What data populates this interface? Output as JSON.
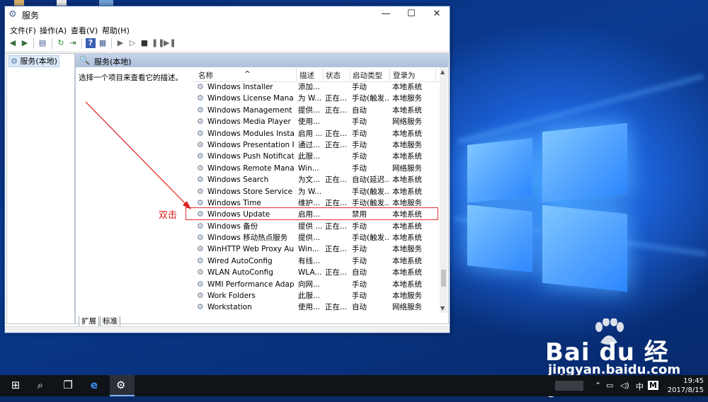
{
  "window": {
    "title": "服务",
    "controls": {
      "minimize": "—",
      "maximize": "☐",
      "close": "✕"
    }
  },
  "menu": [
    "文件(F)",
    "操作(A)",
    "查看(V)",
    "帮助(H)"
  ],
  "tree": {
    "root": "服务(本地)"
  },
  "pane": {
    "title": "服务(本地)",
    "description": "选择一个项目来查看它的描述。"
  },
  "columns": {
    "name": "名称",
    "desc": "描述",
    "status": "状态",
    "startup": "启动类型",
    "logon": "登录为"
  },
  "services": [
    {
      "name": "Windows Installer",
      "desc": "添加...",
      "status": "",
      "startup": "手动",
      "logon": "本地系统"
    },
    {
      "name": "Windows License Manag...",
      "desc": "为 W...",
      "status": "正在...",
      "startup": "手动(触发...",
      "logon": "本地服务"
    },
    {
      "name": "Windows Management I...",
      "desc": "提供...",
      "status": "正在...",
      "startup": "自动",
      "logon": "本地系统"
    },
    {
      "name": "Windows Media Player N...",
      "desc": "使用...",
      "status": "",
      "startup": "手动",
      "logon": "网络服务"
    },
    {
      "name": "Windows Modules Install...",
      "desc": "启用 ...",
      "status": "正在...",
      "startup": "手动",
      "logon": "本地系统"
    },
    {
      "name": "Windows Presentation Fo...",
      "desc": "通过...",
      "status": "正在...",
      "startup": "手动",
      "logon": "本地服务"
    },
    {
      "name": "Windows Push Notificati...",
      "desc": "此服...",
      "status": "",
      "startup": "手动",
      "logon": "本地系统"
    },
    {
      "name": "Windows Remote Manag...",
      "desc": "Win...",
      "status": "",
      "startup": "手动",
      "logon": "网络服务"
    },
    {
      "name": "Windows Search",
      "desc": "为文...",
      "status": "正在...",
      "startup": "自动(延迟...",
      "logon": "本地系统"
    },
    {
      "name": "Windows Store Service (...",
      "desc": "为 W...",
      "status": "",
      "startup": "手动(触发...",
      "logon": "本地系统"
    },
    {
      "name": "Windows Time",
      "desc": "维护...",
      "status": "正在...",
      "startup": "手动(触发...",
      "logon": "本地服务"
    },
    {
      "name": "Windows Update",
      "desc": "启用...",
      "status": "",
      "startup": "禁用",
      "logon": "本地系统"
    },
    {
      "name": "Windows 备份",
      "desc": "提供 ...",
      "status": "正在...",
      "startup": "手动",
      "logon": "本地系统"
    },
    {
      "name": "Windows 移动热点服务",
      "desc": "提供...",
      "status": "",
      "startup": "手动(触发...",
      "logon": "本地系统"
    },
    {
      "name": "WinHTTP Web Proxy Aut...",
      "desc": "Win...",
      "status": "正在...",
      "startup": "手动",
      "logon": "本地服务"
    },
    {
      "name": "Wired AutoConfig",
      "desc": "有线...",
      "status": "",
      "startup": "手动",
      "logon": "本地系统"
    },
    {
      "name": "WLAN AutoConfig",
      "desc": "WLA...",
      "status": "正在...",
      "startup": "自动",
      "logon": "本地系统"
    },
    {
      "name": "WMI Performance Adapt...",
      "desc": "向网...",
      "status": "",
      "startup": "手动",
      "logon": "本地系统"
    },
    {
      "name": "Work Folders",
      "desc": "此服...",
      "status": "",
      "startup": "手动",
      "logon": "本地服务"
    },
    {
      "name": "Workstation",
      "desc": "使用...",
      "status": "正在...",
      "startup": "自动",
      "logon": "网络服务"
    }
  ],
  "tabs": [
    "扩展",
    "标准"
  ],
  "annotation": {
    "label": "双击",
    "color": "#e02020"
  },
  "taskbar": {
    "clock_time": "19:45",
    "clock_date": "2017/8/15",
    "ime": "中",
    "ime_mode": "M"
  },
  "watermark": {
    "brand": "Bai du 经验",
    "url": "jingyan.baidu.com"
  },
  "colors": {
    "accent": "#3a6bb5",
    "highlight_box": "#e03030",
    "desktop": "#0a3a8f"
  }
}
